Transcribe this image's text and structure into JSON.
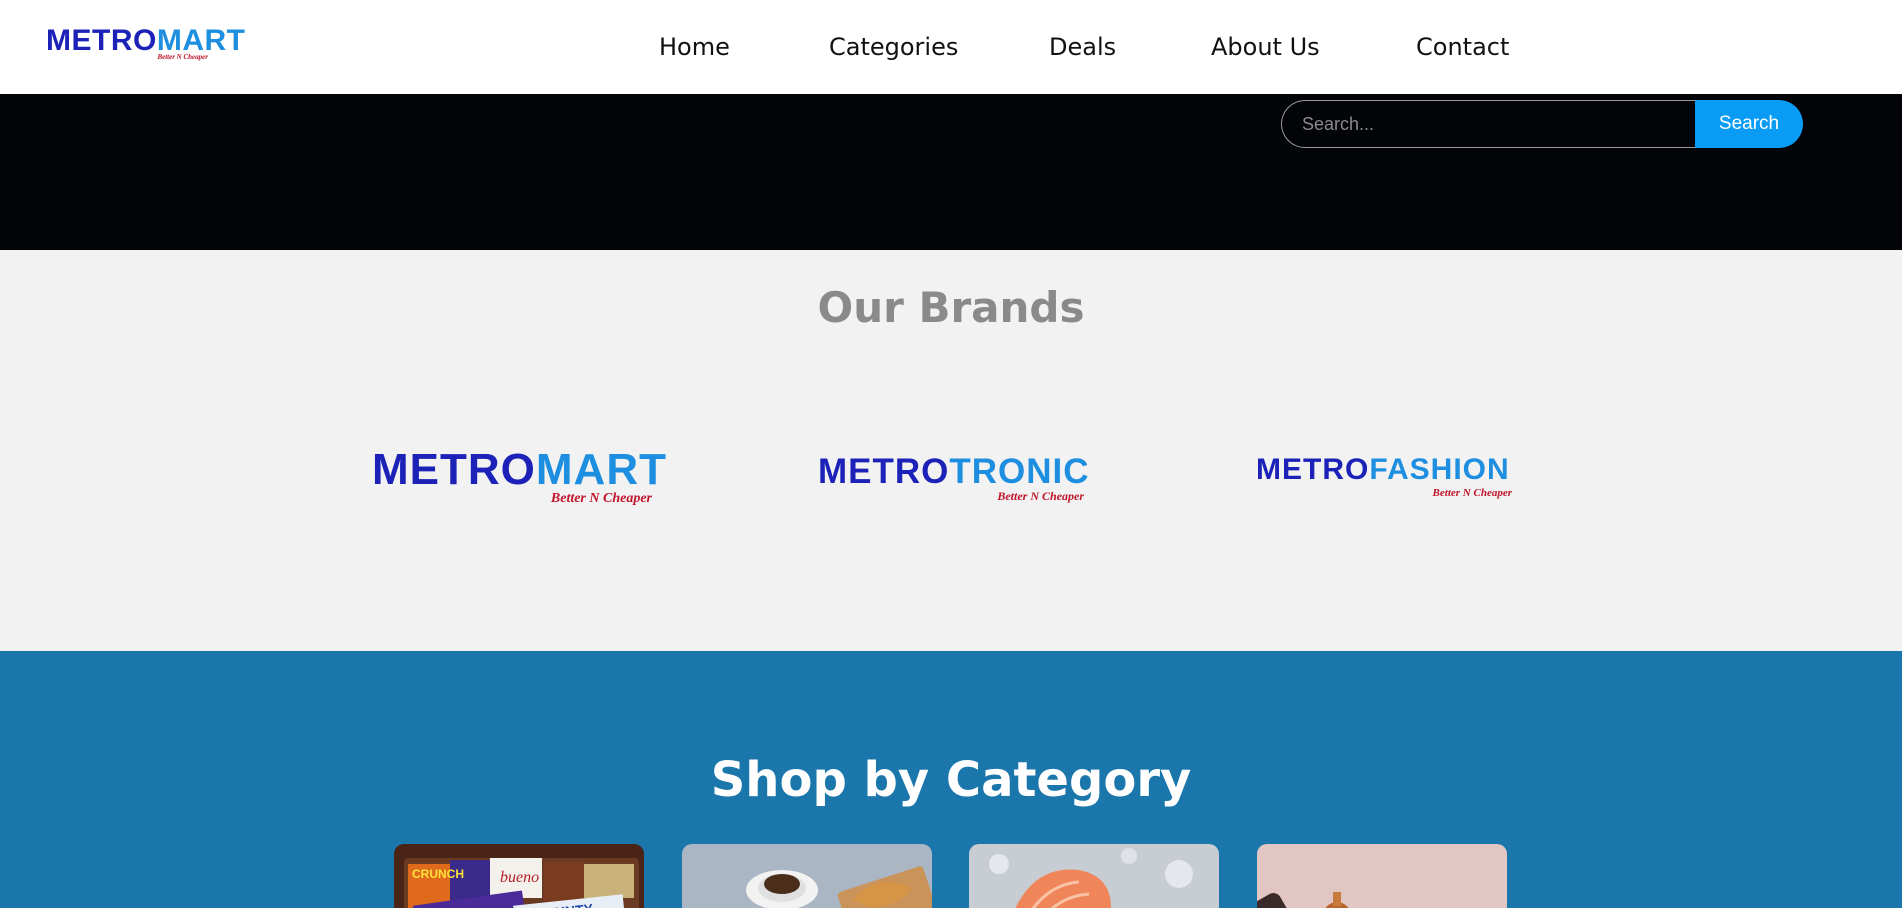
{
  "header": {
    "logo": {
      "part1": "METRO",
      "part2": "MART",
      "tagline": "Better N Cheaper"
    },
    "nav": [
      "Home",
      "Categories",
      "Deals",
      "About Us",
      "Contact"
    ]
  },
  "search": {
    "placeholder": "Search...",
    "button_label": "Search"
  },
  "brands": {
    "title": "Our Brands",
    "items": [
      {
        "part1": "METRO",
        "part2": "MART",
        "tagline": "Better N Cheaper"
      },
      {
        "part1": "METRO",
        "part2": "TRONIC",
        "tagline": "Better N Cheaper"
      },
      {
        "part1": "METRO",
        "part2": "FASHION",
        "tagline": "Better N Cheaper"
      }
    ]
  },
  "categories": {
    "title": "Shop by Category",
    "cards": [
      {
        "icon": "chocolate-bars-image"
      },
      {
        "icon": "coffee-pastry-image"
      },
      {
        "icon": "salmon-fish-image"
      },
      {
        "icon": "cosmetics-bottle-image"
      }
    ]
  },
  "colors": {
    "brand_dark": "#1c22b8",
    "brand_light": "#1e8fe0",
    "tagline": "#c0142a",
    "search_button": "#0a9cf5",
    "category_bg": "#1b77ab",
    "brands_bg": "#f2f2f2",
    "dark_band": "#020408"
  }
}
